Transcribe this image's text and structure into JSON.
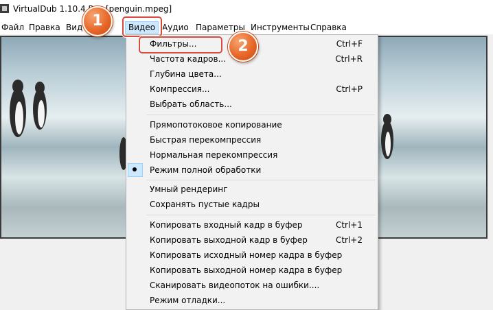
{
  "window": {
    "title": "VirtualDub 1.10.4 Rus [penguin.mpeg]"
  },
  "menubar": {
    "items": [
      {
        "label": "Файл"
      },
      {
        "label": "Правка"
      },
      {
        "label": "Вид"
      },
      {
        "label": "Видео"
      },
      {
        "label": "Аудио"
      },
      {
        "label": "Параметры"
      },
      {
        "label": "Инструменты"
      },
      {
        "label": "Справка"
      }
    ]
  },
  "video_menu": {
    "items": [
      {
        "label": "Фильтры...",
        "shortcut": "Ctrl+F"
      },
      {
        "label": "Частота кадров...",
        "shortcut": "Ctrl+R"
      },
      {
        "label": "Глубина цвета...",
        "shortcut": ""
      },
      {
        "label": "Компрессия...",
        "shortcut": "Ctrl+P"
      },
      {
        "label": "Выбрать область...",
        "shortcut": ""
      },
      {
        "label": "Прямопотоковое копирование",
        "shortcut": ""
      },
      {
        "label": "Быстрая перекомпрессия",
        "shortcut": ""
      },
      {
        "label": "Нормальная перекомпрессия",
        "shortcut": ""
      },
      {
        "label": "Режим полной обработки",
        "shortcut": "",
        "checked": true
      },
      {
        "label": "Умный рендеринг",
        "shortcut": ""
      },
      {
        "label": "Сохранять пустые кадры",
        "shortcut": ""
      },
      {
        "label": "Копировать входный кадр в буфер",
        "shortcut": "Ctrl+1"
      },
      {
        "label": "Копировать выходной кадр в буфер",
        "shortcut": "Ctrl+2"
      },
      {
        "label": "Копировать исходный номер кадра в буфер",
        "shortcut": ""
      },
      {
        "label": "Копировать выходной номер кадра в буфер",
        "shortcut": ""
      },
      {
        "label": "Сканировать видеопоток на ошибки....",
        "shortcut": ""
      },
      {
        "label": "Режим отладки...",
        "shortcut": ""
      }
    ]
  },
  "annotations": {
    "step1": "1",
    "step2": "2",
    "highlight_color": "#d94a3d",
    "badge_color": "#e8682a"
  },
  "colors": {
    "menu_hover": "#cce8ff",
    "menu_bg": "#f2f2f2"
  }
}
